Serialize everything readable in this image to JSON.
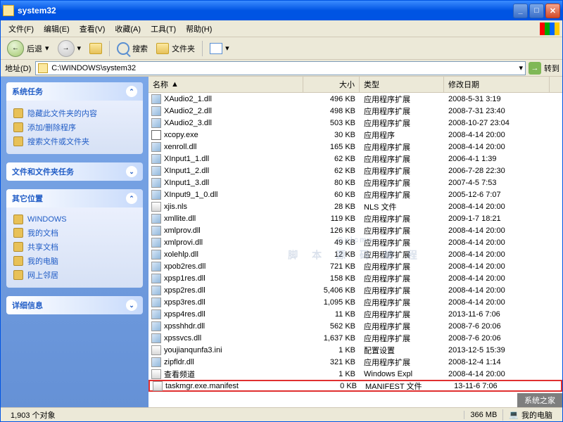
{
  "window": {
    "title": "system32"
  },
  "menus": {
    "file": "文件(F)",
    "edit": "编辑(E)",
    "view": "查看(V)",
    "favorites": "收藏(A)",
    "tools": "工具(T)",
    "help": "帮助(H)"
  },
  "toolbar": {
    "back": "后退",
    "search": "搜索",
    "folders": "文件夹"
  },
  "addressbar": {
    "label": "地址(D)",
    "path": "C:\\WINDOWS\\system32",
    "go": "转到"
  },
  "sidebar": {
    "panels": [
      {
        "title": "系统任务",
        "links": [
          "隐藏此文件夹的内容",
          "添加/删除程序",
          "搜索文件或文件夹"
        ]
      },
      {
        "title": "文件和文件夹任务",
        "links": []
      },
      {
        "title": "其它位置",
        "links": [
          "WINDOWS",
          "我的文档",
          "共享文档",
          "我的电脑",
          "网上邻居"
        ]
      },
      {
        "title": "详细信息",
        "links": []
      }
    ]
  },
  "columns": {
    "name": "名称",
    "size": "大小",
    "type": "类型",
    "date": "修改日期"
  },
  "files": [
    {
      "name": "XAudio2_1.dll",
      "icon": "dll",
      "size": "496 KB",
      "type": "应用程序扩展",
      "date": "2008-5-31 3:19"
    },
    {
      "name": "XAudio2_2.dll",
      "icon": "dll",
      "size": "498 KB",
      "type": "应用程序扩展",
      "date": "2008-7-31 23:40"
    },
    {
      "name": "XAudio2_3.dll",
      "icon": "dll",
      "size": "503 KB",
      "type": "应用程序扩展",
      "date": "2008-10-27 23:04"
    },
    {
      "name": "xcopy.exe",
      "icon": "exe",
      "size": "30 KB",
      "type": "应用程序",
      "date": "2008-4-14 20:00"
    },
    {
      "name": "xenroll.dll",
      "icon": "dll",
      "size": "165 KB",
      "type": "应用程序扩展",
      "date": "2008-4-14 20:00"
    },
    {
      "name": "XInput1_1.dll",
      "icon": "dll",
      "size": "62 KB",
      "type": "应用程序扩展",
      "date": "2006-4-1 1:39"
    },
    {
      "name": "XInput1_2.dll",
      "icon": "dll",
      "size": "62 KB",
      "type": "应用程序扩展",
      "date": "2006-7-28 22:30"
    },
    {
      "name": "XInput1_3.dll",
      "icon": "dll",
      "size": "80 KB",
      "type": "应用程序扩展",
      "date": "2007-4-5 7:53"
    },
    {
      "name": "XInput9_1_0.dll",
      "icon": "dll",
      "size": "60 KB",
      "type": "应用程序扩展",
      "date": "2005-12-6 7:07"
    },
    {
      "name": "xjis.nls",
      "icon": "ini",
      "size": "28 KB",
      "type": "NLS 文件",
      "date": "2008-4-14 20:00"
    },
    {
      "name": "xmllite.dll",
      "icon": "dll",
      "size": "119 KB",
      "type": "应用程序扩展",
      "date": "2009-1-7 18:21"
    },
    {
      "name": "xmlprov.dll",
      "icon": "dll",
      "size": "126 KB",
      "type": "应用程序扩展",
      "date": "2008-4-14 20:00"
    },
    {
      "name": "xmlprovi.dll",
      "icon": "dll",
      "size": "49 KB",
      "type": "应用程序扩展",
      "date": "2008-4-14 20:00"
    },
    {
      "name": "xolehlp.dll",
      "icon": "dll",
      "size": "12 KB",
      "type": "应用程序扩展",
      "date": "2008-4-14 20:00"
    },
    {
      "name": "xpob2res.dll",
      "icon": "dll",
      "size": "721 KB",
      "type": "应用程序扩展",
      "date": "2008-4-14 20:00"
    },
    {
      "name": "xpsp1res.dll",
      "icon": "dll",
      "size": "158 KB",
      "type": "应用程序扩展",
      "date": "2008-4-14 20:00"
    },
    {
      "name": "xpsp2res.dll",
      "icon": "dll",
      "size": "5,406 KB",
      "type": "应用程序扩展",
      "date": "2008-4-14 20:00"
    },
    {
      "name": "xpsp3res.dll",
      "icon": "dll",
      "size": "1,095 KB",
      "type": "应用程序扩展",
      "date": "2008-4-14 20:00"
    },
    {
      "name": "xpsp4res.dll",
      "icon": "dll",
      "size": "11 KB",
      "type": "应用程序扩展",
      "date": "2013-11-6 7:06"
    },
    {
      "name": "xpsshhdr.dll",
      "icon": "dll",
      "size": "562 KB",
      "type": "应用程序扩展",
      "date": "2008-7-6 20:06"
    },
    {
      "name": "xpssvcs.dll",
      "icon": "dll",
      "size": "1,637 KB",
      "type": "应用程序扩展",
      "date": "2008-7-6 20:06"
    },
    {
      "name": "youjianqunfa3.ini",
      "icon": "ini",
      "size": "1 KB",
      "type": "配置设置",
      "date": "2013-12-5 15:39"
    },
    {
      "name": "zipfldr.dll",
      "icon": "dll",
      "size": "321 KB",
      "type": "应用程序扩展",
      "date": "2008-12-4 1:14"
    },
    {
      "name": "查看频道",
      "icon": "ini",
      "size": "1 KB",
      "type": "Windows Expl",
      "date": "2008-4-14 20:00"
    },
    {
      "name": "taskmgr.exe.manifest",
      "icon": "ini",
      "size": "0 KB",
      "type": "MANIFEST 文件",
      "date": "  13-11-6 7:06",
      "highlight": true
    }
  ],
  "statusbar": {
    "objects": "1,903 个对象",
    "size": "366 MB",
    "location": "我的电脑"
  },
  "watermark": {
    "main": "Gxlcms",
    "sub": "脚 本 源 码 编 程"
  },
  "overlay": "系统之家"
}
